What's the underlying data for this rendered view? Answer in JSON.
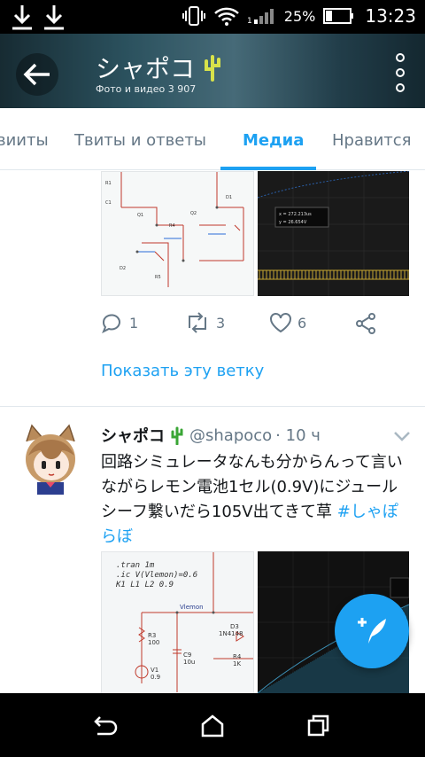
{
  "status_bar": {
    "battery_percent": "25%",
    "time": "13:23"
  },
  "header": {
    "title": "シャポコ",
    "title_emoji": "🌵",
    "subtitle": "Фото и видео 3 907"
  },
  "tabs": [
    {
      "label": "вииты"
    },
    {
      "label": "Твиты и ответы"
    },
    {
      "label": "Медиа",
      "active": true
    },
    {
      "label": "Нравится"
    }
  ],
  "prev_tweet": {
    "actions": {
      "reply_count": "1",
      "retweet_count": "3",
      "like_count": "6"
    },
    "show_thread": "Показать эту ветку",
    "scope_readout": {
      "x": "x = 272.213us",
      "y": "y = 26.654V"
    }
  },
  "tweet": {
    "name": "シャポコ",
    "name_emoji": "🌵",
    "handle": "@shapoco",
    "time": "· 10 ч",
    "text": "回路シミュレータなんも分からんって言いながらレモン電池1セル(0.9V)にジュールシーフ繋いだら105V出てきて草 ",
    "hashtag": "#しゃぽらぼ",
    "sim_lines": [
      ".tran 1m",
      ".ic V(Vlemon)=0.6",
      "K1 L1 L2 0.9"
    ]
  },
  "colors": {
    "accent": "#1da1f2",
    "text_primary": "#14171a",
    "text_secondary": "#657786"
  }
}
